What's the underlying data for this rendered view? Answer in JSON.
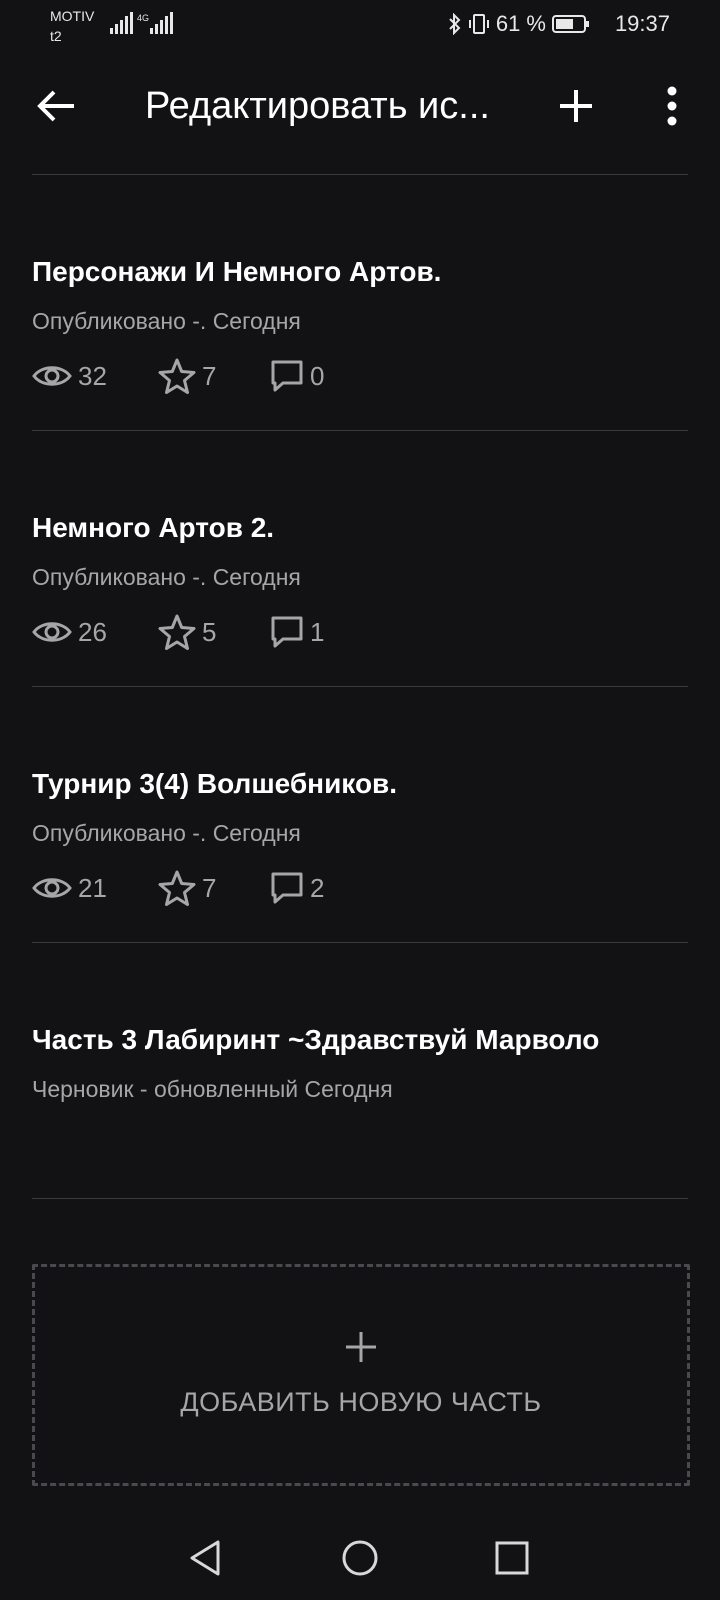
{
  "status_bar": {
    "carrier": "MOTIV",
    "carrier2": "t2",
    "network": "4G",
    "battery_percent": "61 %",
    "time": "19:37"
  },
  "toolbar": {
    "title": "Редактировать ис..."
  },
  "parts": [
    {
      "title": "Персонажи И Немного Артов.",
      "status": "Опубликовано -. Сегодня",
      "views": "32",
      "votes": "7",
      "comments": "0"
    },
    {
      "title": "Немного Артов 2.",
      "status": "Опубликовано -. Сегодня",
      "views": "26",
      "votes": "5",
      "comments": "1"
    },
    {
      "title": "Турнир 3(4) Волшебников.",
      "status": "Опубликовано -. Сегодня",
      "views": "21",
      "votes": "7",
      "comments": "2"
    },
    {
      "title": "Часть 3 Лабиринт ~Здравствуй Марволо",
      "status": "Черновик - обновленный Сегодня"
    }
  ],
  "add_part": {
    "label": "ДОБАВИТЬ НОВУЮ ЧАСТЬ"
  },
  "icons": {
    "back": "arrow-back-icon",
    "add": "plus-icon",
    "more": "more-vertical-icon",
    "views": "eye-icon",
    "votes": "star-icon",
    "comments": "comment-icon",
    "nav_back": "triangle-back-icon",
    "nav_home": "circle-home-icon",
    "nav_recents": "square-recents-icon"
  },
  "colors": {
    "background": "#121114",
    "text_primary": "#ffffff",
    "text_secondary": "#a6a6a8",
    "divider": "#3a3a3e"
  }
}
